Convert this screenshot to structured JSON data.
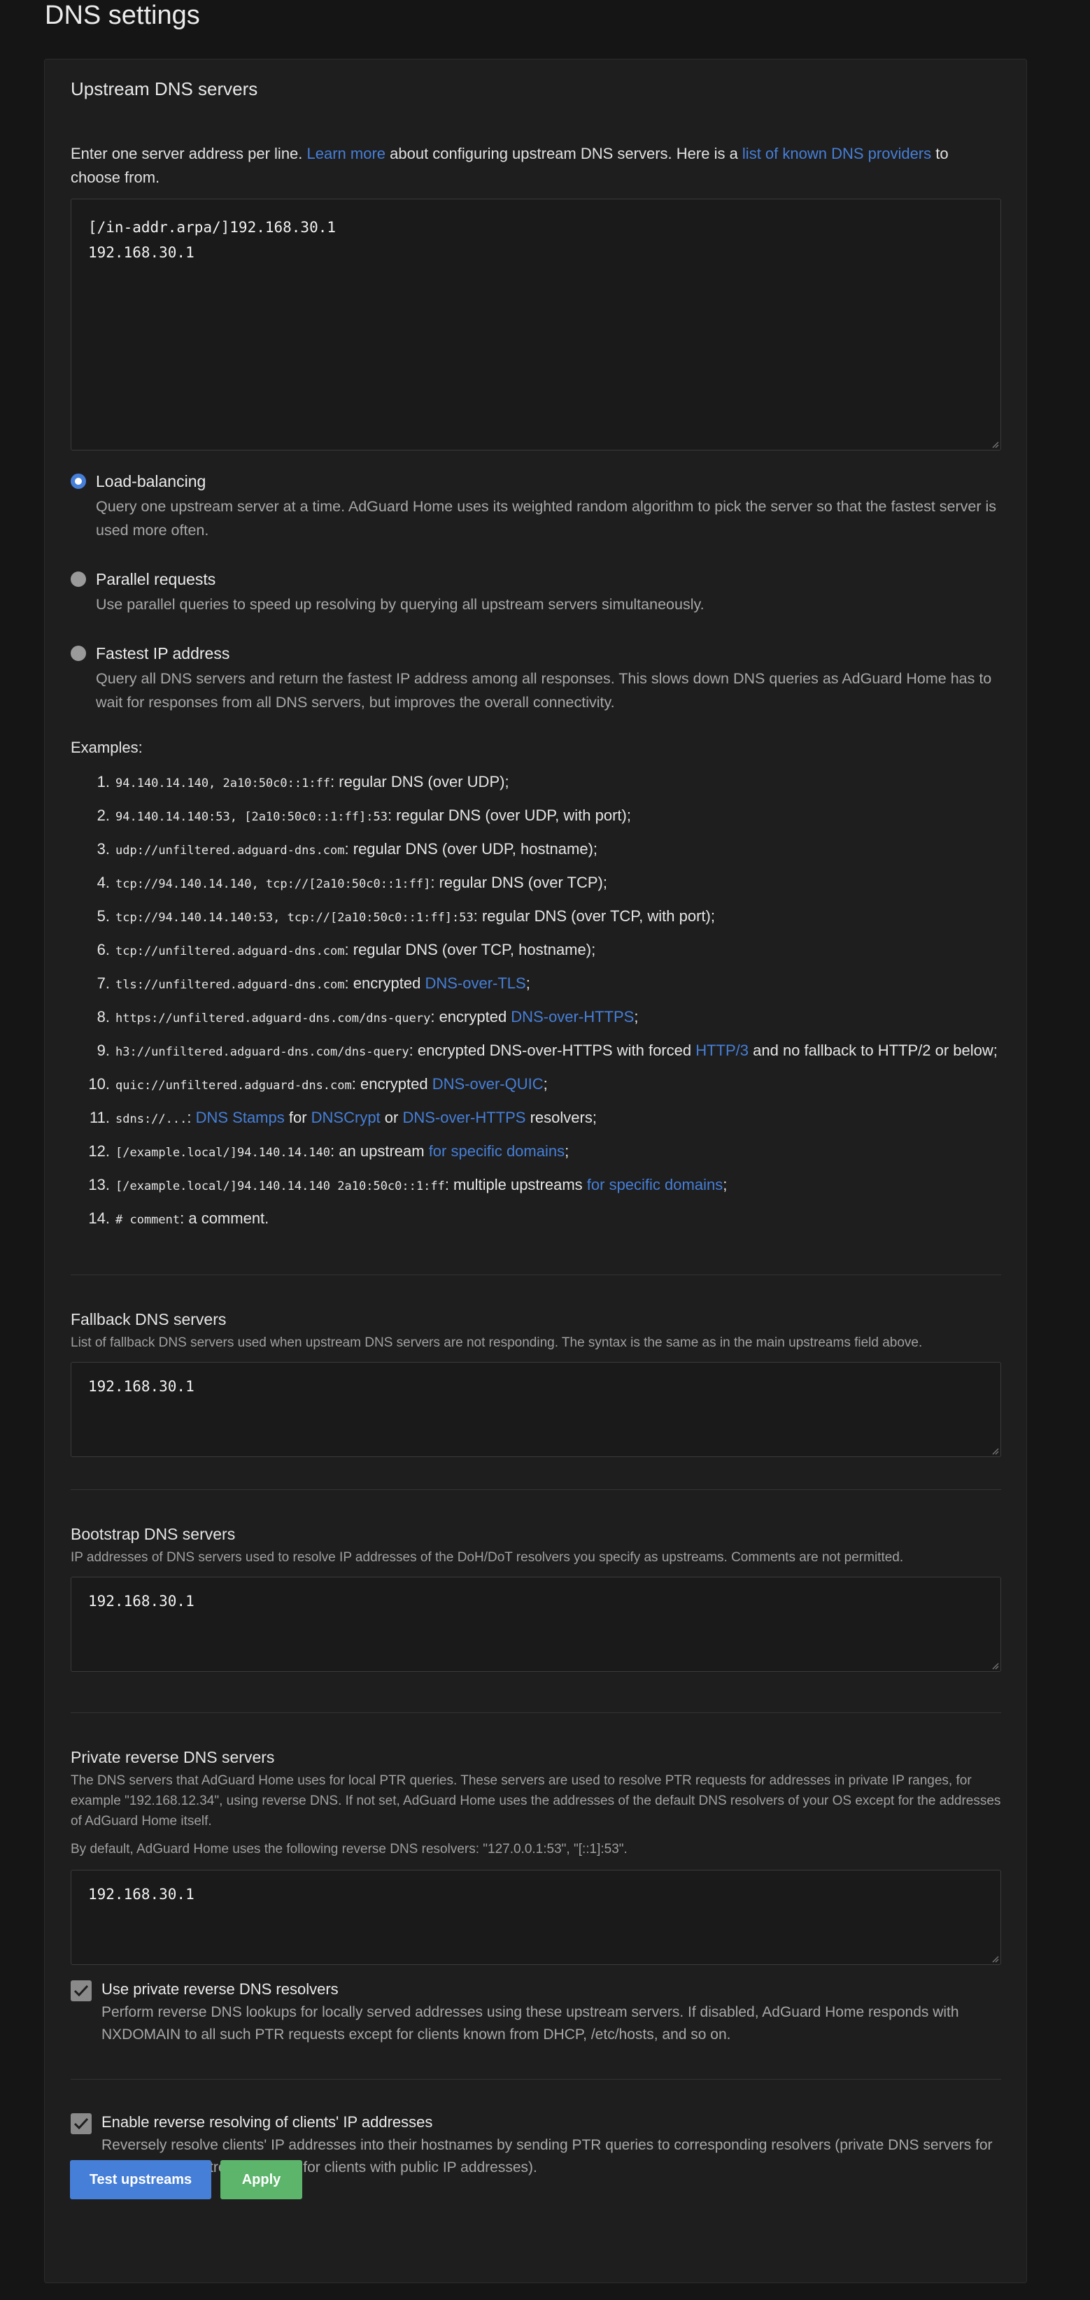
{
  "page": {
    "title": "DNS settings"
  },
  "upstream": {
    "title": "Upstream DNS servers",
    "intro_before": "Enter one server address per line. ",
    "learn_more": "Learn more",
    "intro_middle": " about configuring upstream DNS servers. Here is a ",
    "providers_link": "list of known DNS providers",
    "intro_after": " to choose from.",
    "lines": [
      "[/in-addr.arpa/]192.168.30.1",
      "192.168.30.1"
    ]
  },
  "modes": [
    {
      "label": "Load-balancing",
      "description": "Query one upstream server at a time. AdGuard Home uses its weighted random algorithm to pick the server so that the fastest server is used more often.",
      "checked": true
    },
    {
      "label": "Parallel requests",
      "description": "Use parallel queries to speed up resolving by querying all upstream servers simultaneously.",
      "checked": false
    },
    {
      "label": "Fastest IP address",
      "description": "Query all DNS servers and return the fastest IP address among all responses. This slows down DNS queries as AdGuard Home has to wait for responses from all DNS servers, but improves the overall connectivity.",
      "checked": false
    }
  ],
  "examples": {
    "label": "Examples:",
    "items": [
      {
        "n": "1.",
        "code": "94.140.14.140, 2a10:50c0::1:ff",
        "text": ": regular DNS (over UDP);"
      },
      {
        "n": "2.",
        "code": "94.140.14.140:53, [2a10:50c0::1:ff]:53",
        "text": ": regular DNS (over UDP, with port);"
      },
      {
        "n": "3.",
        "code": "udp://unfiltered.adguard-dns.com",
        "text": ": regular DNS (over UDP, hostname);"
      },
      {
        "n": "4.",
        "code": "tcp://94.140.14.140, tcp://[2a10:50c0::1:ff]",
        "text": ": regular DNS (over TCP);"
      },
      {
        "n": "5.",
        "code": "tcp://94.140.14.140:53, tcp://[2a10:50c0::1:ff]:53",
        "text": ": regular DNS (over TCP, with port);"
      },
      {
        "n": "6.",
        "code": "tcp://unfiltered.adguard-dns.com",
        "text": ": regular DNS (over TCP, hostname);"
      },
      {
        "n": "7.",
        "code": "tls://unfiltered.adguard-dns.com",
        "text": ": encrypted ",
        "link": "DNS-over-TLS",
        "after": ";"
      },
      {
        "n": "8.",
        "code": "https://unfiltered.adguard-dns.com/dns-query",
        "text": ": encrypted ",
        "link": "DNS-over-HTTPS",
        "after": ";"
      },
      {
        "n": "9.",
        "code": "h3://unfiltered.adguard-dns.com/dns-query",
        "text": ": encrypted DNS-over-HTTPS with forced ",
        "link": "HTTP/3",
        "after": " and no fallback to HTTP/2 or below;"
      },
      {
        "n": "10.",
        "code": "quic://unfiltered.adguard-dns.com",
        "text": ": encrypted ",
        "link": "DNS-over-QUIC",
        "after": ";"
      },
      {
        "n": "11.",
        "code": "sdns://...",
        "text": ": ",
        "link": "DNS Stamps",
        "mid1": " for ",
        "link2": "DNSCrypt",
        "mid2": " or ",
        "link3": "DNS-over-HTTPS",
        "after": " resolvers;"
      },
      {
        "n": "12.",
        "code": "[/example.local/]94.140.14.140",
        "text": ": an upstream ",
        "link": "for specific domains",
        "after": ";"
      },
      {
        "n": "13.",
        "code": "[/example.local/]94.140.14.140 2a10:50c0::1:ff",
        "text": ": multiple upstreams ",
        "link": "for specific domains",
        "after": ";"
      },
      {
        "n": "14.",
        "code": "# comment",
        "text": ": a comment."
      }
    ]
  },
  "fallback": {
    "title": "Fallback DNS servers",
    "description": "List of fallback DNS servers used when upstream DNS servers are not responding. The syntax is the same as in the main upstreams field above.",
    "value": "192.168.30.1"
  },
  "bootstrap": {
    "title": "Bootstrap DNS servers",
    "description": "IP addresses of DNS servers used to resolve IP addresses of the DoH/DoT resolvers you specify as upstreams. Comments are not permitted.",
    "value": "192.168.30.1"
  },
  "private_rdns": {
    "title": "Private reverse DNS servers",
    "description": "The DNS servers that AdGuard Home uses for local PTR queries. These servers are used to resolve PTR requests for addresses in private IP ranges, for example \"192.168.12.34\", using reverse DNS. If not set, AdGuard Home uses the addresses of the default DNS resolvers of your OS except for the addresses of AdGuard Home itself.",
    "default_note": "By default, AdGuard Home uses the following reverse DNS resolvers: \"127.0.0.1:53\", \"[::1]:53\".",
    "value": "192.168.30.1"
  },
  "use_private": {
    "label": "Use private reverse DNS resolvers",
    "description": "Perform reverse DNS lookups for locally served addresses using these upstream servers. If disabled, AdGuard Home responds with NXDOMAIN to all such PTR requests except for clients known from DHCP, /etc/hosts, and so on.",
    "checked": true
  },
  "enable_rdns": {
    "label": "Enable reverse resolving of clients' IP addresses",
    "description": "Reversely resolve clients' IP addresses into their hostnames by sending PTR queries to corresponding resolvers (private DNS servers for local clients, upstream servers for clients with public IP addresses).",
    "checked": true
  },
  "buttons": {
    "test": "Test upstreams",
    "apply": "Apply"
  },
  "colors": {
    "accent": "#467fd8",
    "apply": "#5cb56b",
    "background": "#151515",
    "card": "#1e1e1e"
  }
}
